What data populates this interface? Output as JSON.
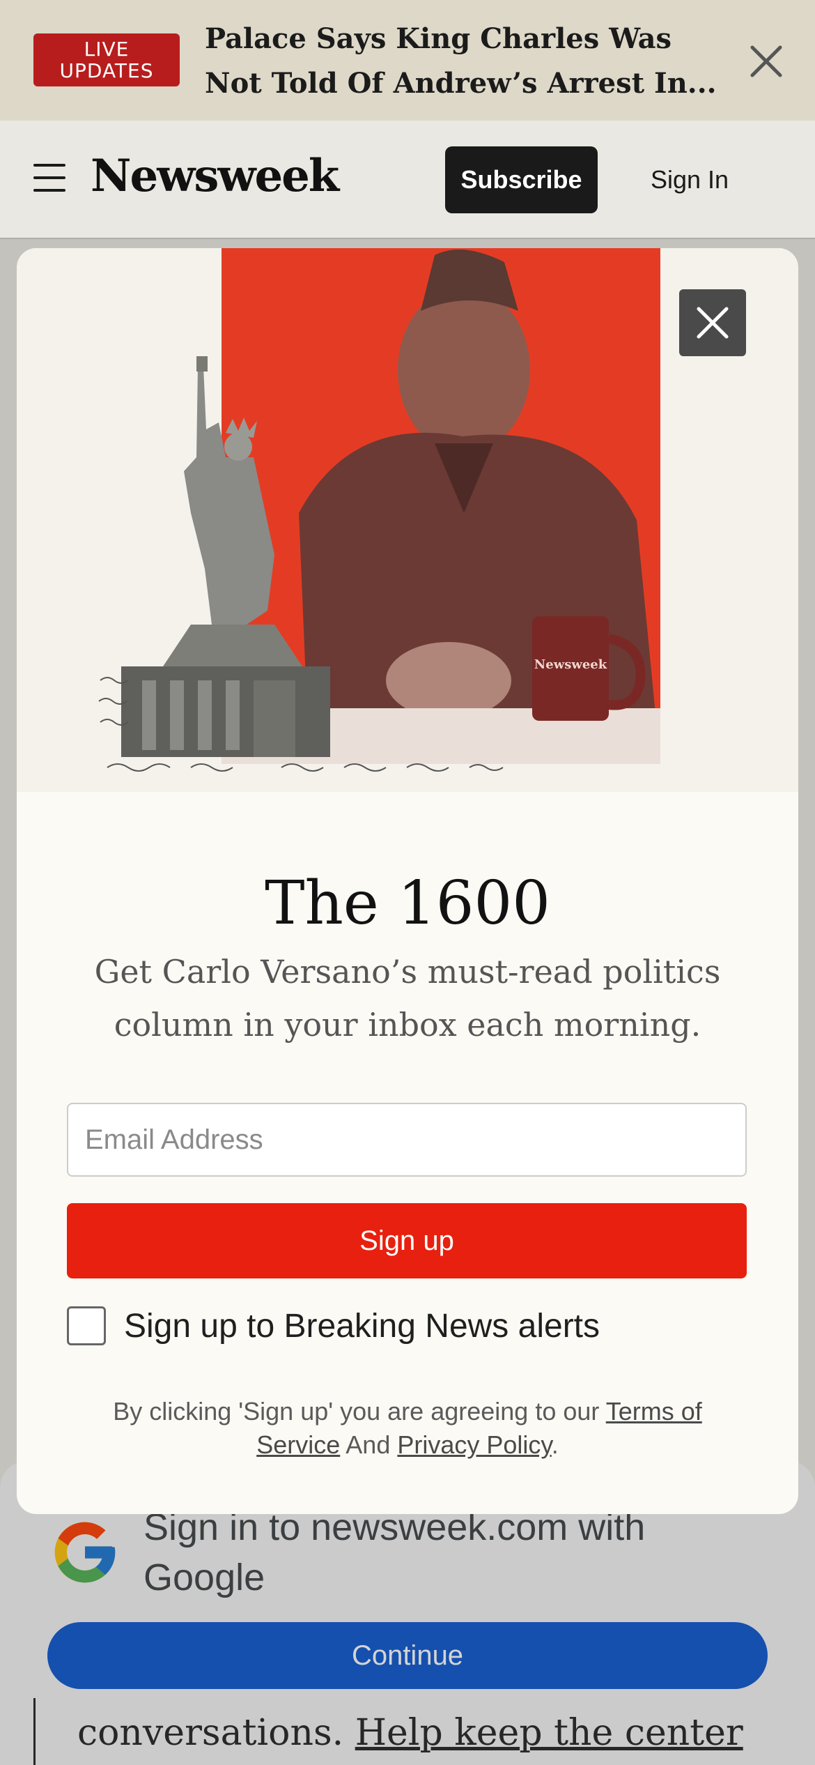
{
  "live_banner": {
    "badge_line1": "LIVE",
    "badge_line2": "UPDATES",
    "headline": "Palace Says King Charles Was Not Told Of Andrew’s Arrest In..."
  },
  "header": {
    "logo": "Newsweek",
    "subscribe_label": "Subscribe",
    "signin_label": "Sign In"
  },
  "modal": {
    "title": "The 1600",
    "description": "Get Carlo Versano’s must-read politics column in your inbox each morning.",
    "email_placeholder": "Email Address",
    "signup_label": "Sign up",
    "alerts_label": "Sign up to Breaking News alerts",
    "alerts_checked": false,
    "legal_prefix": "By clicking 'Sign up' you are agreeing to our",
    "terms_link": "Terms of Service",
    "legal_and": "And",
    "privacy_link": "Privacy Policy",
    "legal_suffix": ".",
    "hero_mug_text": "Newsweek"
  },
  "google_prompt": {
    "title": "Sign in to newsweek.com with Google",
    "continue_label": "Continue"
  },
  "background_article": {
    "text_start": "conversations.",
    "link_text": "Help keep the center"
  },
  "colors": {
    "accent_red": "#e8200f",
    "live_badge_red": "#b81d1d",
    "google_blue": "#0b57d0",
    "header_bg": "#e9e8e2"
  },
  "icons": [
    "close-icon",
    "menu-icon",
    "google-logo-icon",
    "checkbox-icon"
  ]
}
